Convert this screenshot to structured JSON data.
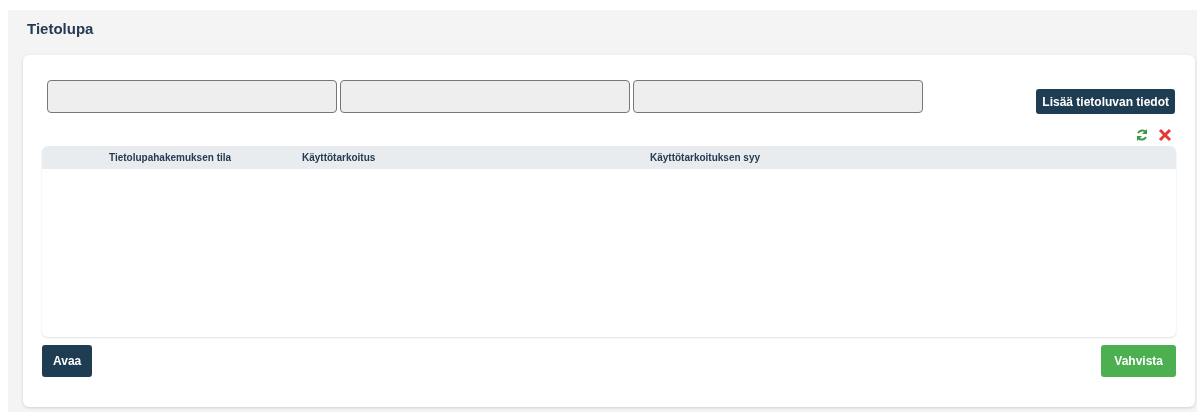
{
  "title": "Tietolupa",
  "fields": [
    {
      "kind": "text"
    },
    {
      "kind": "text"
    },
    {
      "kind": "text"
    }
  ],
  "add_button": "Lisää tietoluvan tiedot",
  "table": {
    "columns": [
      "Tietolupahakemuksen tila",
      "Käyttötarkoitus",
      "Käyttötarkoituksen syy"
    ]
  },
  "buttons": [
    {
      "label": "Avaa",
      "kind": "primary"
    },
    {
      "label": "Vahvista",
      "kind": "success"
    }
  ]
}
